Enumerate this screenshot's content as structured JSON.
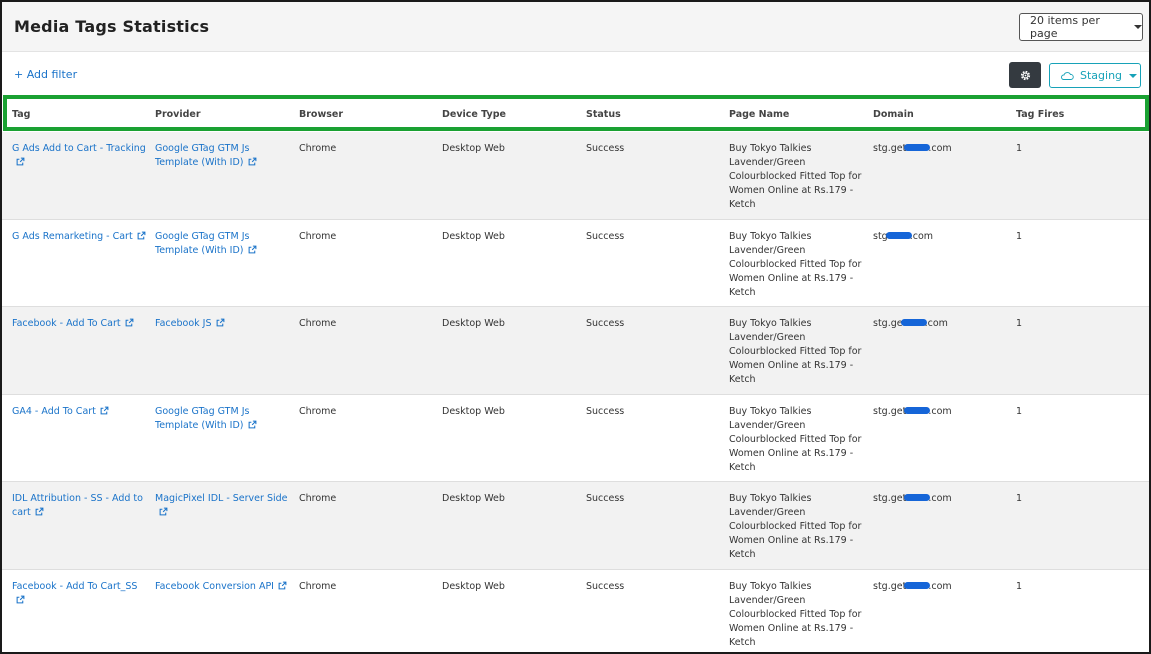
{
  "page": {
    "title": "Media Tags Statistics",
    "items_per_page_label": "20 items per page",
    "add_filter_label": "+ Add filter",
    "environment_label": "Staging"
  },
  "columns": [
    "Tag",
    "Provider",
    "Browser",
    "Device Type",
    "Status",
    "Page Name",
    "Domain",
    "Tag Fires"
  ],
  "rows": [
    {
      "tag_line1": "G Ads Add to Cart - Tracking",
      "tag_line2": "",
      "provider_line1": "Google GTag GTM Js",
      "provider_line2": "Template (With ID)",
      "browser": "Chrome",
      "device_type": "Desktop Web",
      "status": "Success",
      "page_name": [
        "Buy Tokyo Talkies",
        "Lavender/Green",
        "Colourblocked Fitted Top for",
        "Women Online at Rs.179 -",
        "Ketch"
      ],
      "domain_prefix": "stg.get",
      "domain_suffix": ".com",
      "tag_fires": "1"
    },
    {
      "tag_line1": "G Ads Remarketing - Cart",
      "tag_line2": "",
      "provider_line1": "Google GTag GTM Js",
      "provider_line2": "Template (With ID)",
      "browser": "Chrome",
      "device_type": "Desktop Web",
      "status": "Success",
      "page_name": [
        "Buy Tokyo Talkies",
        "Lavender/Green",
        "Colourblocked Fitted Top for",
        "Women Online at Rs.179 -",
        "Ketch"
      ],
      "domain_prefix": "stg",
      "domain_suffix": ".com",
      "tag_fires": "1"
    },
    {
      "tag_line1": "Facebook - Add To Cart",
      "tag_line2": "",
      "provider_line1": "Facebook JS",
      "provider_line2": "",
      "browser": "Chrome",
      "device_type": "Desktop Web",
      "status": "Success",
      "page_name": [
        "Buy Tokyo Talkies",
        "Lavender/Green",
        "Colourblocked Fitted Top for",
        "Women Online at Rs.179 -",
        "Ketch"
      ],
      "domain_prefix": "stg.ge",
      "domain_suffix": ".com",
      "tag_fires": "1"
    },
    {
      "tag_line1": "GA4 - Add To Cart",
      "tag_line2": "",
      "provider_line1": "Google GTag GTM Js",
      "provider_line2": "Template (With ID)",
      "browser": "Chrome",
      "device_type": "Desktop Web",
      "status": "Success",
      "page_name": [
        "Buy Tokyo Talkies",
        "Lavender/Green",
        "Colourblocked Fitted Top for",
        "Women Online at Rs.179 -",
        "Ketch"
      ],
      "domain_prefix": "stg.get",
      "domain_suffix": ".com",
      "tag_fires": "1"
    },
    {
      "tag_line1": "IDL Attribution - SS - Add to",
      "tag_line2": "cart",
      "provider_line1": "MagicPixel IDL - Server Side",
      "provider_line2": "",
      "browser": "Chrome",
      "device_type": "Desktop Web",
      "status": "Success",
      "page_name": [
        "Buy Tokyo Talkies",
        "Lavender/Green",
        "Colourblocked Fitted Top for",
        "Women Online at Rs.179 -",
        "Ketch"
      ],
      "domain_prefix": "stg.get",
      "domain_suffix": ".com",
      "tag_fires": "1"
    },
    {
      "tag_line1": "Facebook - Add To Cart_SS",
      "tag_line2": "",
      "provider_line1": "Facebook Conversion API",
      "provider_line2": "",
      "browser": "Chrome",
      "device_type": "Desktop Web",
      "status": "Success",
      "page_name": [
        "Buy Tokyo Talkies",
        "Lavender/Green",
        "Colourblocked Fitted Top for",
        "Women Online at Rs.179 -",
        "Ketch"
      ],
      "domain_prefix": "stg.get",
      "domain_suffix": ".com",
      "tag_fires": "1"
    }
  ],
  "icons": {
    "settings": "gear-icon",
    "environment": "cloud-icon",
    "external_link": "external-link-icon",
    "dropdown": "chevron-down-icon"
  },
  "colors": {
    "link": "#1a73c9",
    "highlight_border": "#1aa132",
    "env_accent": "#17a2b8",
    "settings_button": "#343a40",
    "redaction": "#1565d8"
  }
}
